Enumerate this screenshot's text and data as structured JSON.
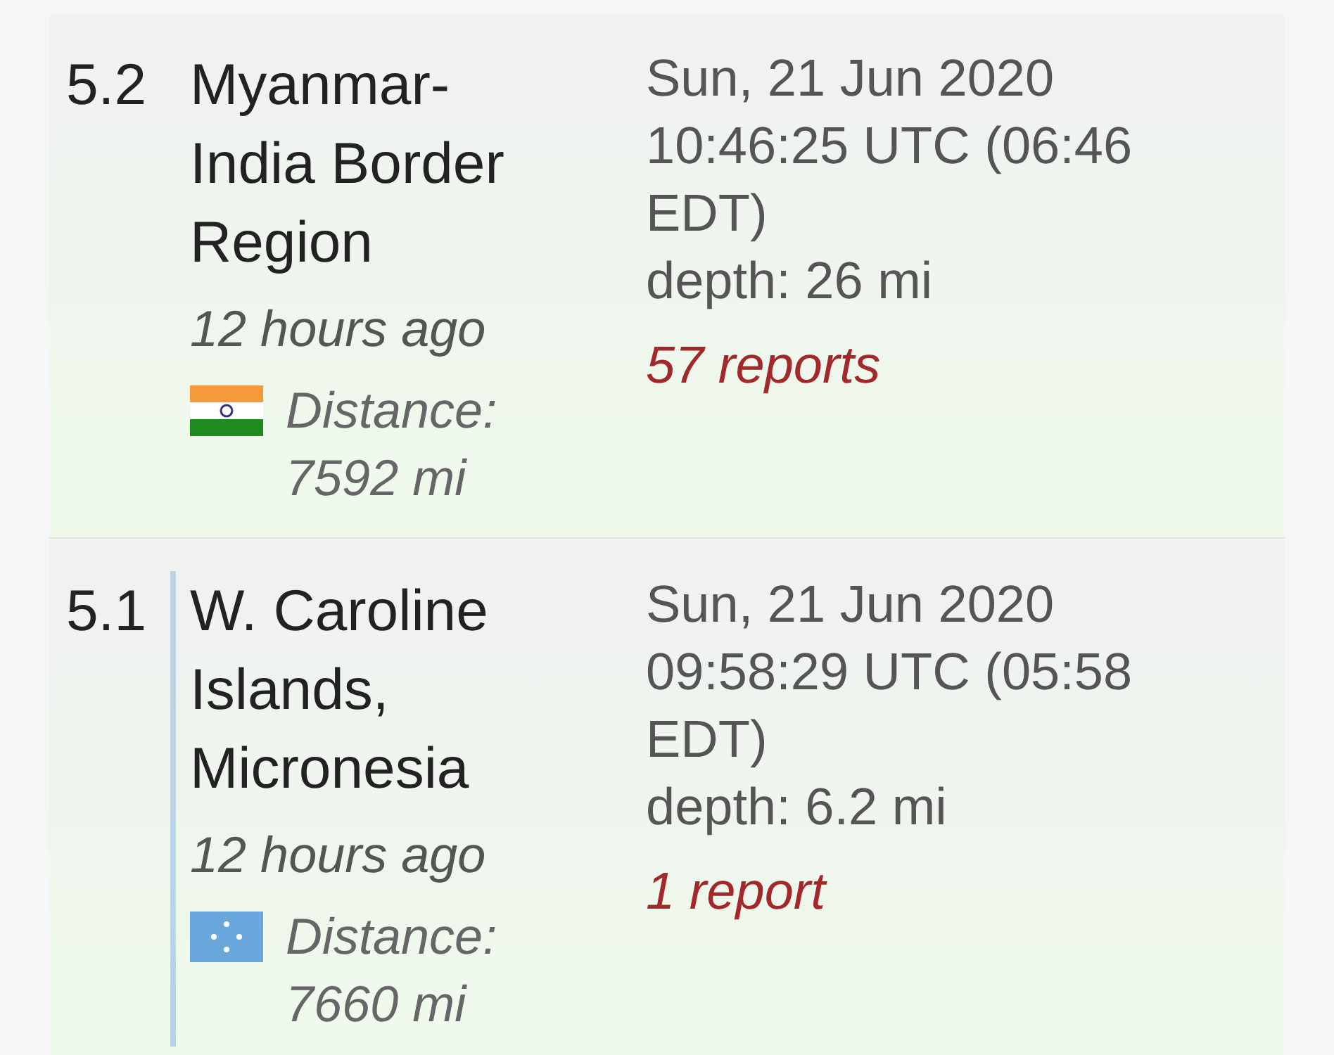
{
  "quakes": [
    {
      "magnitude": "5.2",
      "place": "Myanmar-India Border Region",
      "ago": "12 hours ago",
      "flag": {
        "kind": "india"
      },
      "distance_label": "Distance:",
      "distance": "7592 mi",
      "date": "Sun, 21 Jun 2020",
      "time": "10:46:25 UTC (06:46 EDT)",
      "depth": "depth: 26 mi",
      "reports": "57 reports",
      "highlighted": false
    },
    {
      "magnitude": "5.1",
      "place": "W. Caroline Islands, Micronesia",
      "ago": "12 hours ago",
      "flag": {
        "kind": "micronesia"
      },
      "distance_label": "Distance:",
      "distance": "7660 mi",
      "date": "Sun, 21 Jun 2020",
      "time": "09:58:29 UTC (05:58 EDT)",
      "depth": "depth: 6.2 mi",
      "reports": "1 report",
      "highlighted": true
    }
  ]
}
